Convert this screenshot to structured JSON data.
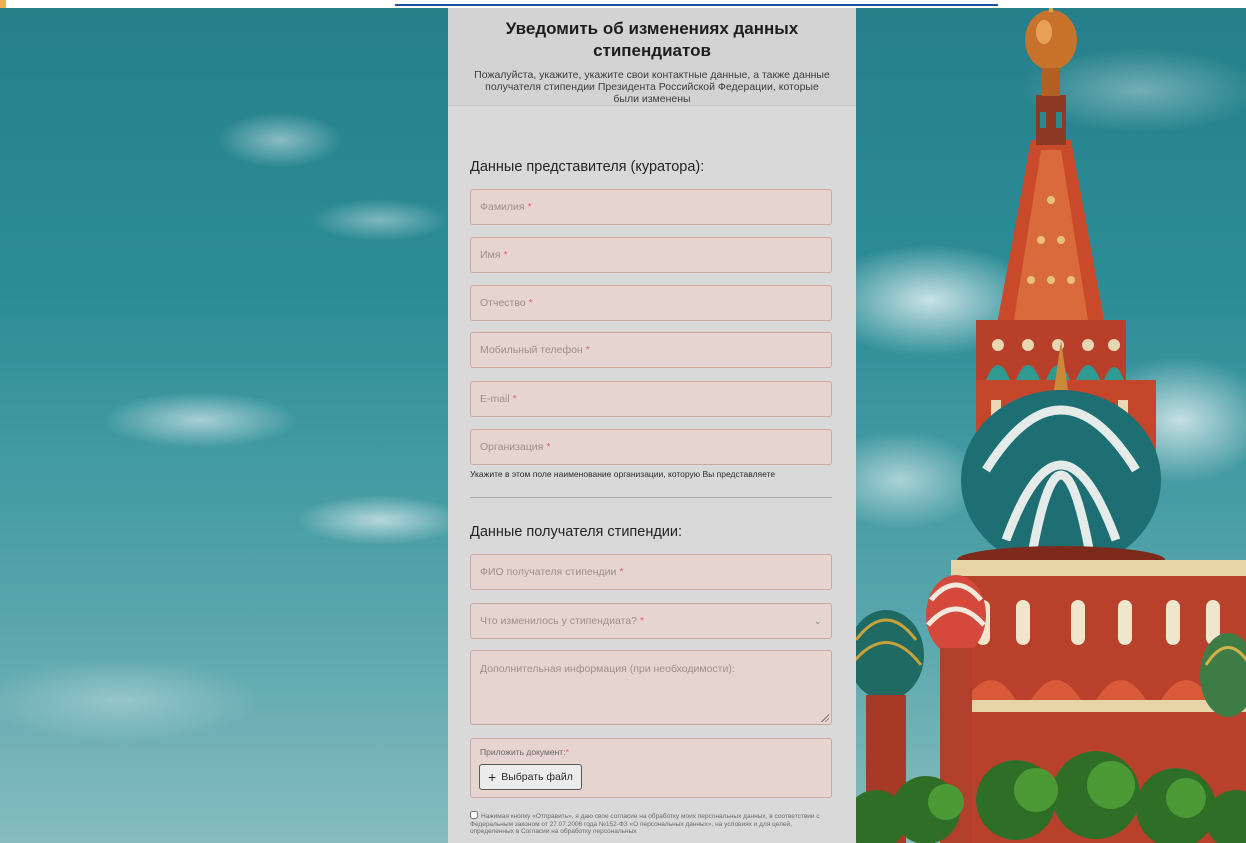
{
  "header": {
    "title": "Уведомить об изменениях данных стипендиатов",
    "subtitle": "Пожалуйста, укажите, укажите свои контактные данные, а также данные получателя стипендии Президента Российской Федерации, которые были изменены"
  },
  "curator": {
    "section_title": "Данные представителя (куратора):",
    "fields": {
      "last_name": "Фамилия",
      "first_name": "Имя",
      "patronymic": "Отчество",
      "phone": "Мобильный телефон",
      "email": "E-mail",
      "organization": "Организация"
    },
    "organization_hint": "Укажите в этом поле наименование организации, которую Вы представляете"
  },
  "recipient": {
    "section_title": "Данные получателя стипендии:",
    "fio": "ФИО получателя стипендии",
    "change_select": "Что изменилось у стипендиата?",
    "additional_info": "Дополнительная информация (при необходимости):",
    "attach_label": "Приложить документ:",
    "attach_button": "Выбрать файл"
  },
  "required_mark": "*",
  "consent": {
    "text": "Нажимая кнопку «Отправить», я даю свое согласие на обработку моих персональных данных, в соответствии с Федеральным законом от 27.07.2006 года №152-ФЗ «О персональных данных», на условиях и для целей, определенных в Согласии на обработку персональных",
    "checked": false
  },
  "colors": {
    "panel_bg": "#d9d9d9",
    "field_bg": "#e5d4d0",
    "field_border": "#cda8a1",
    "required": "#e06060"
  },
  "icons": {
    "select": "chevron-down-icon",
    "attach": "plus-icon"
  }
}
